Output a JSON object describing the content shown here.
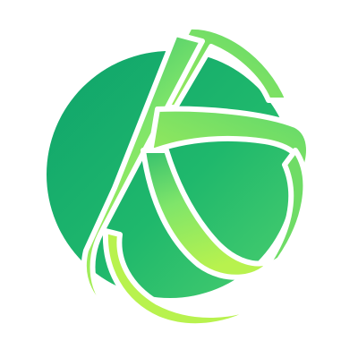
{
  "logo": {
    "icon": "k-orbit-planet-logo-icon",
    "colors": {
      "background": "#ffffff",
      "sphere_dark": "#0fa36b",
      "sphere_light": "#4ccf6e",
      "ribbon_top": "#35c06e",
      "ribbon_mid": "#7fe56a",
      "ribbon_bottom": "#b8f24e",
      "gap": "#ffffff"
    }
  }
}
